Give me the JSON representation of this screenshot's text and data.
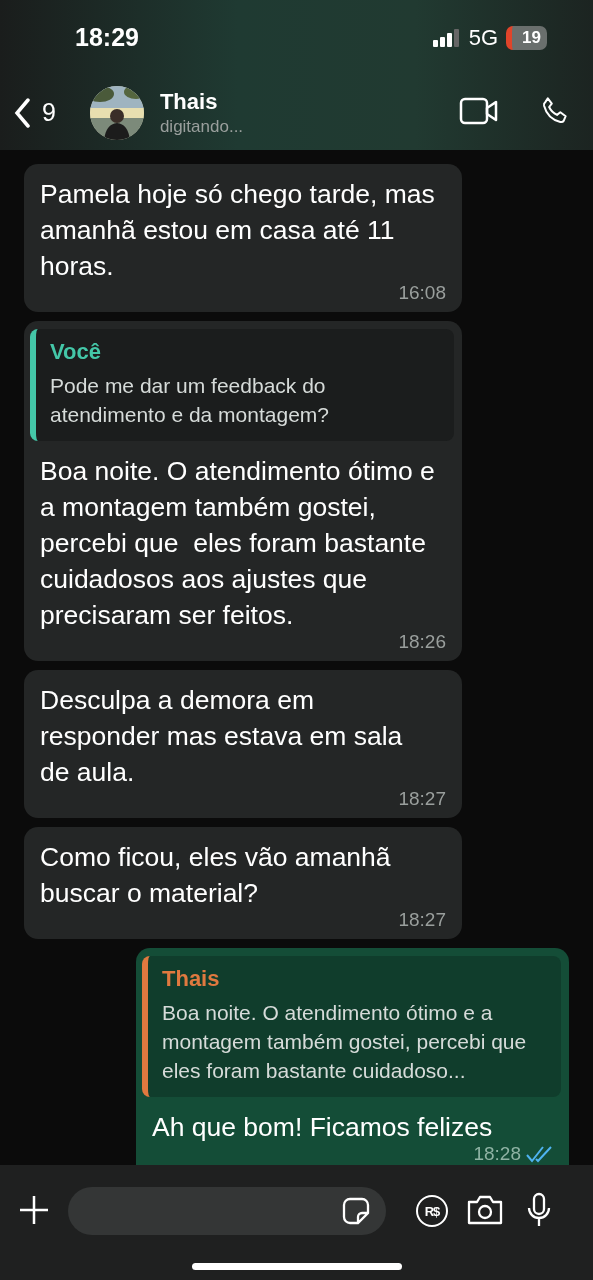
{
  "status_bar": {
    "time": "18:29",
    "network": "5G",
    "battery": "19"
  },
  "header": {
    "back_count": "9",
    "contact_name": "Thais",
    "status": "digitando..."
  },
  "messages": [
    {
      "kind": "incoming",
      "text": "Pamela hoje só chego tarde, mas amanhã estou em casa até 11 horas.",
      "time": "16:08"
    },
    {
      "kind": "incoming",
      "reply": {
        "author": "Você",
        "text": "Pode me dar um feedback do atendimento e da montagem?"
      },
      "text": "Boa noite. O atendimento ótimo e a montagem também gostei, percebi que  eles foram bastante cuidadosos aos ajustes que precisaram ser feitos.",
      "time": "18:26"
    },
    {
      "kind": "incoming",
      "text": "Desculpa a demora em responder mas estava em sala de aula.",
      "time": "18:27"
    },
    {
      "kind": "incoming",
      "text": "Como ficou, eles vão amanhã buscar o material?",
      "time": "18:27"
    },
    {
      "kind": "outgoing",
      "reply": {
        "author": "Thais",
        "text": "Boa noite. O atendimento ótimo e a montagem também gostei, percebi que  eles foram bastante cuidadoso..."
      },
      "text": "Ah que bom! Ficamos felizes",
      "time": "18:28",
      "read": true
    }
  ],
  "composer": {
    "payment_label": "R$"
  }
}
